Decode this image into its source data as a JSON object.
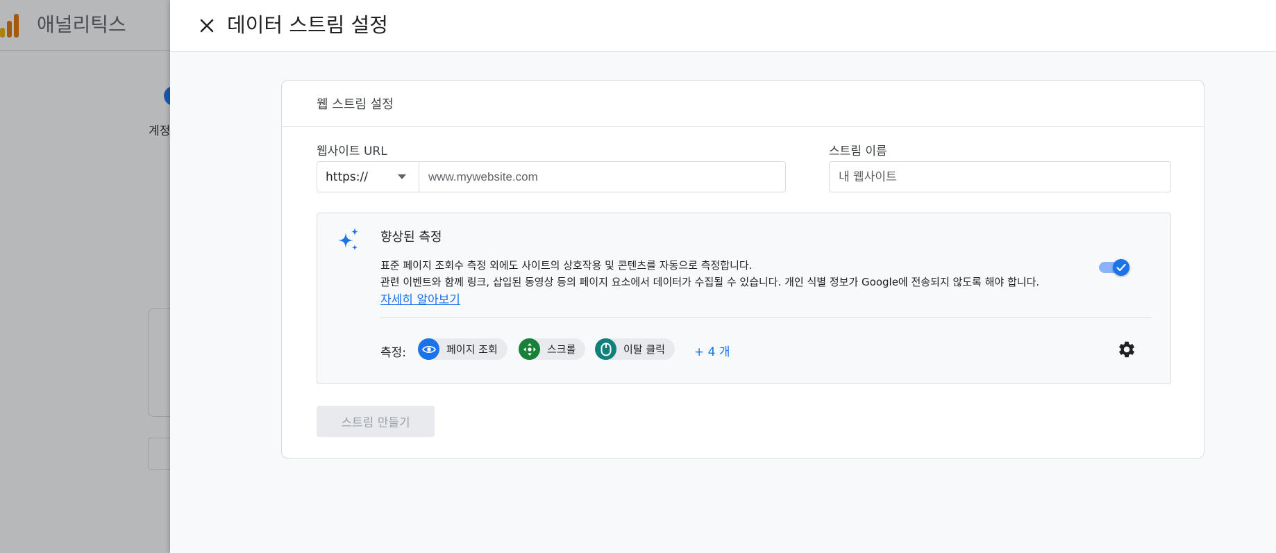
{
  "background": {
    "app_title": "애널리틱스",
    "step_label": "계정"
  },
  "panel": {
    "title": "데이터 스트림 설정"
  },
  "form": {
    "card_title": "웹 스트림 설정",
    "url_label": "웹사이트 URL",
    "protocol_value": "https://",
    "url_placeholder": "www.mywebsite.com",
    "name_label": "스트림 이름",
    "name_placeholder": "내 웹사이트"
  },
  "enhanced_measurement": {
    "title": "향상된 측정",
    "description_line1": "표준 페이지 조회수 측정 외에도 사이트의 상호작용 및 콘텐츠를 자동으로 측정합니다.",
    "description_line2": "관련 이벤트와 함께 링크, 삽입된 동영상 등의 페이지 요소에서 데이터가 수집될 수 있습니다. 개인 식별 정보가 Google에 전송되지 않도록 해야 합니다.",
    "learn_more": "자세히 알아보기",
    "enabled": true,
    "measure_label": "측정:",
    "chips": [
      {
        "label": "페이지 조회",
        "icon": "eye-icon",
        "color": "#1a73e8"
      },
      {
        "label": "스크롤",
        "icon": "scroll-icon",
        "color": "#188038"
      },
      {
        "label": "이탈 클릭",
        "icon": "mouse-icon",
        "color": "#12807a"
      }
    ],
    "more": "+ 4 개"
  },
  "actions": {
    "create_button": "스트림 만들기"
  },
  "colors": {
    "accent": "#1a73e8",
    "toggle_track": "#8ab4f8"
  }
}
